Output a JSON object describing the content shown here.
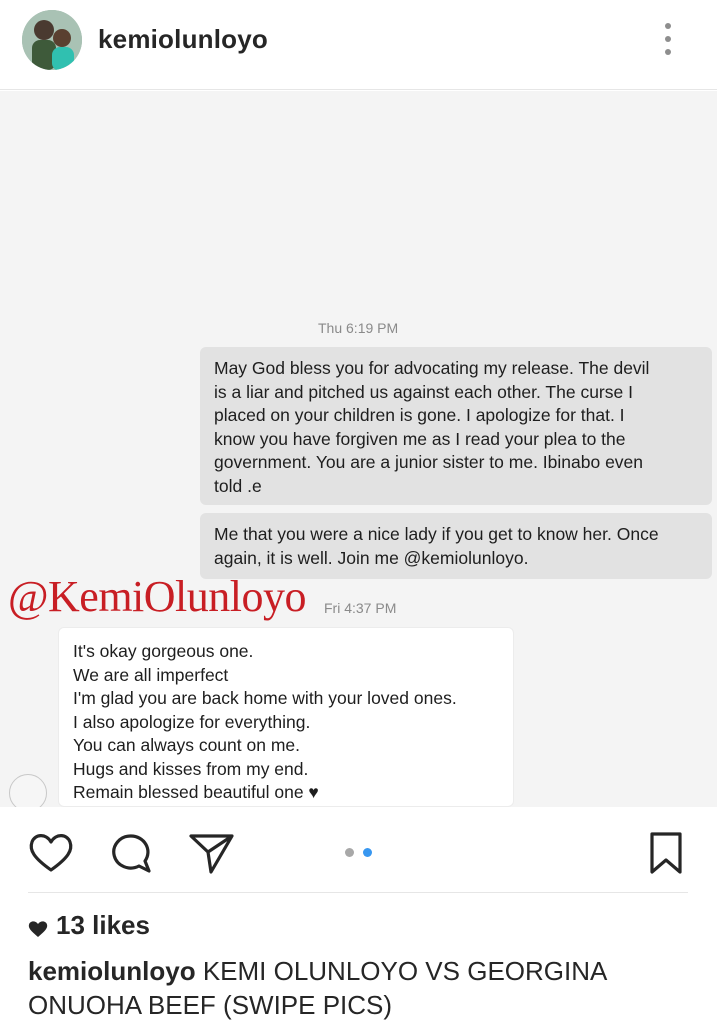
{
  "header": {
    "username": "kemiolunloyo",
    "more_icon": "more-vertical-icon"
  },
  "photo": {
    "timestamp_1": "Thu 6:19 PM",
    "message_1": [
      "May God bless you for advocating my release. The devil",
      "is a liar and pitched us against each other. The curse I",
      "placed on your children is gone. I apologize for that. I",
      "know you have forgiven me as I read your plea to the",
      "government. You are a junior sister to me. Ibinabo even",
      "told .e"
    ],
    "message_2": [
      "Me that you were a nice lady if you get to know her. Once",
      "again, it is well. Join me @kemiolunloyo."
    ],
    "watermark": "@KemiOlunloyo",
    "timestamp_2": "Fri 4:37 PM",
    "message_3": [
      "It's okay gorgeous one.",
      "We are all imperfect",
      "I'm glad you are back home with your loved ones.",
      "I also apologize for everything.",
      "You can always count on me.",
      "Hugs and kisses from my end.",
      "Remain blessed beautiful one ♥"
    ],
    "watermark_color": "#c81e24"
  },
  "actions": {
    "icons": [
      "heart-outline-icon",
      "comment-icon",
      "share-icon",
      "bookmark-icon"
    ],
    "carousel": {
      "count": 2,
      "active_index": 1,
      "active_color": "#3897f0",
      "inactive_color": "#a8a8a8"
    }
  },
  "likes": {
    "text": "13 likes"
  },
  "caption": {
    "username": "kemiolunloyo",
    "text": "KEMI OLUNLOYO VS GEORGINA ONUOHA BEEF (SWIPE PICS)"
  }
}
